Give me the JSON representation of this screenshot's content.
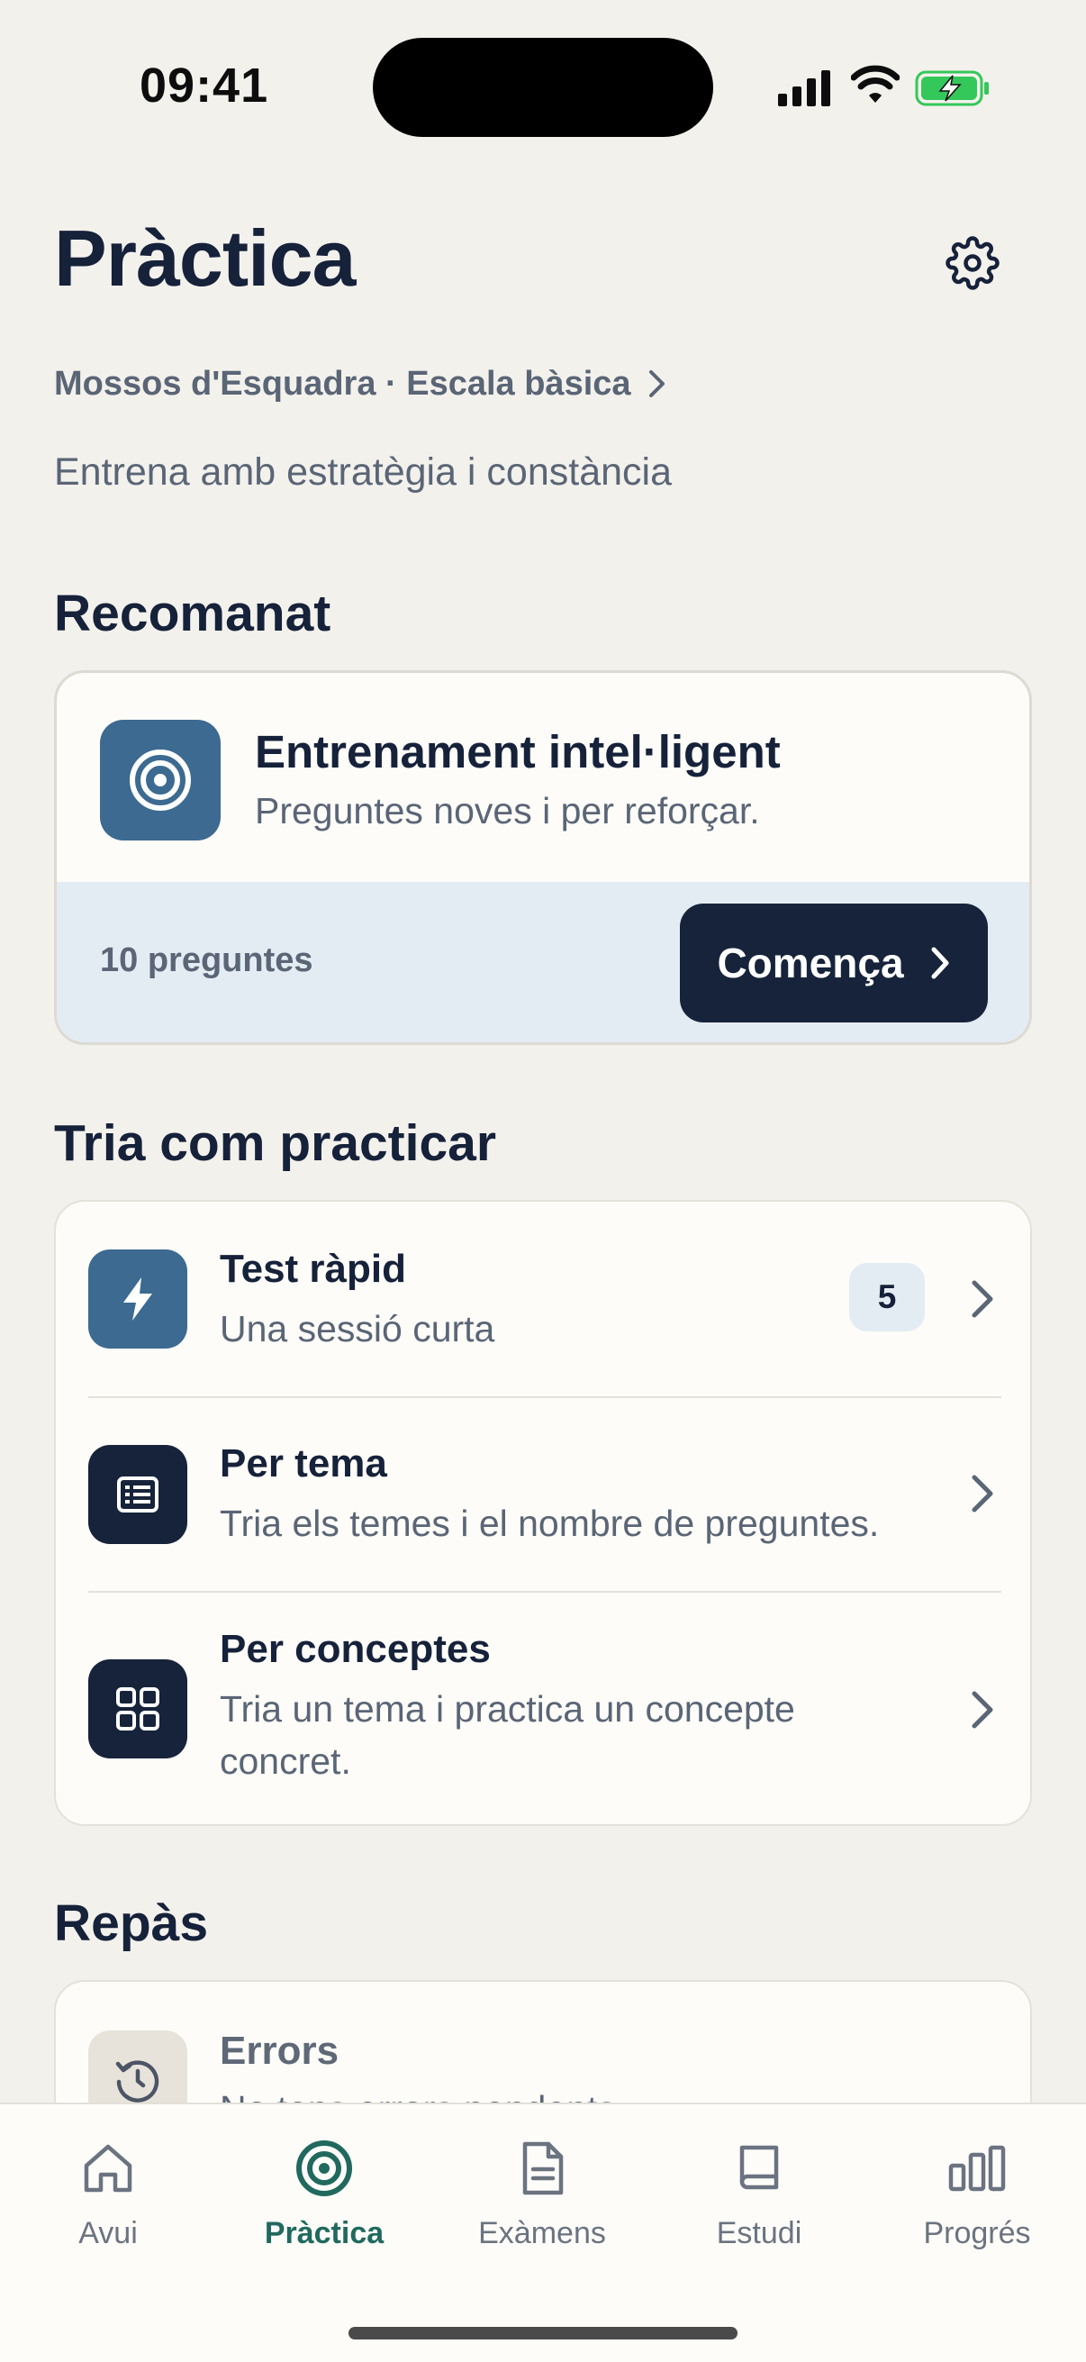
{
  "status_bar": {
    "time": "09:41"
  },
  "header": {
    "title": "Pràctica",
    "breadcrumb": "Mossos d'Esquadra · Escala bàsica",
    "subtitle": "Entrena amb estratègia i constància"
  },
  "recommended": {
    "section_title": "Recomanat",
    "title": "Entrenament intel·ligent",
    "description": "Preguntes noves i per reforçar.",
    "count": "10 preguntes",
    "start_label": "Comença"
  },
  "practice": {
    "section_title": "Tria com practicar",
    "options": [
      {
        "title": "Test ràpid",
        "description": "Una sessió curta",
        "badge": "5",
        "icon": "bolt-icon"
      },
      {
        "title": "Per tema",
        "description": "Tria els temes i el nombre de preguntes.",
        "icon": "list-document-icon"
      },
      {
        "title": "Per conceptes",
        "description": "Tria un tema i practica un concepte concret.",
        "icon": "grid-icon"
      }
    ]
  },
  "review": {
    "section_title": "Repàs",
    "title": "Errors",
    "description": "No tens errors pendents."
  },
  "tabs": [
    {
      "label": "Avui",
      "icon": "home-icon"
    },
    {
      "label": "Pràctica",
      "icon": "target-icon",
      "active": true
    },
    {
      "label": "Exàmens",
      "icon": "document-icon"
    },
    {
      "label": "Estudi",
      "icon": "book-icon"
    },
    {
      "label": "Progrés",
      "icon": "bar-chart-icon"
    }
  ],
  "colors": {
    "background": "#f3f1ec",
    "primary_dark": "#16233b",
    "accent_blue": "#3c6a91",
    "active_tab": "#21695e",
    "battery_green": "#34c759"
  }
}
